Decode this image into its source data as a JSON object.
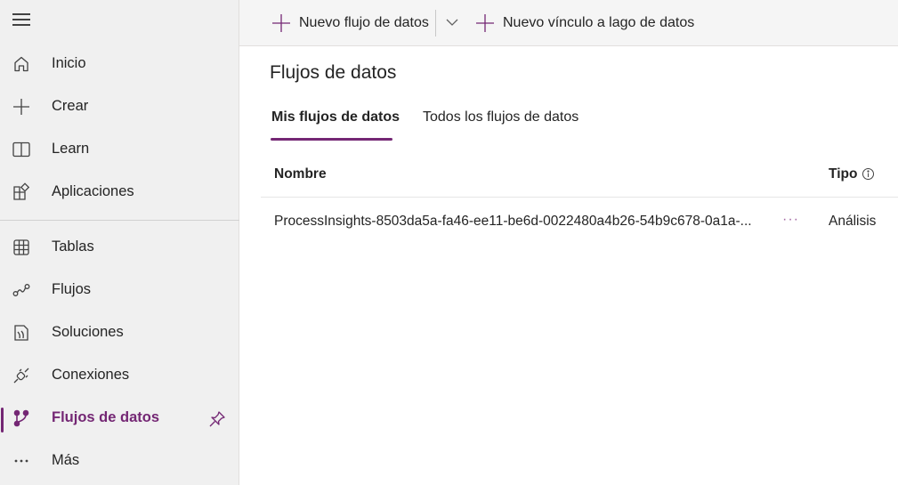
{
  "sidebar": {
    "items": [
      {
        "label": "Inicio",
        "icon": "home-icon"
      },
      {
        "label": "Crear",
        "icon": "plus-icon"
      },
      {
        "label": "Learn",
        "icon": "book-icon"
      },
      {
        "label": "Aplicaciones",
        "icon": "apps-icon"
      },
      {
        "label": "Tablas",
        "icon": "table-icon"
      },
      {
        "label": "Flujos",
        "icon": "flow-icon"
      },
      {
        "label": "Soluciones",
        "icon": "solutions-icon"
      },
      {
        "label": "Conexiones",
        "icon": "connection-icon"
      },
      {
        "label": "Flujos de datos",
        "icon": "dataflow-icon",
        "active": true
      },
      {
        "label": "Más",
        "icon": "more-icon"
      }
    ]
  },
  "toolbar": {
    "new_dataflow_label": "Nuevo flujo de datos",
    "new_datalake_link_label": "Nuevo vínculo a lago de datos"
  },
  "main": {
    "title": "Flujos de datos",
    "tabs": [
      {
        "label": "Mis flujos de datos",
        "active": true
      },
      {
        "label": "Todos los flujos de datos",
        "active": false
      }
    ],
    "table": {
      "columns": [
        "Nombre",
        "Tipo"
      ],
      "rows": [
        {
          "name": "ProcessInsights-8503da5a-fa46-ee11-be6d-0022480a4b26-54b9c678-0a1a-...",
          "more": "···",
          "type": "Análisis"
        }
      ]
    }
  },
  "colors": {
    "accent": "#742774",
    "sidebar_bg": "#f0f0f0",
    "toolbar_bg": "#f5f5f5"
  }
}
